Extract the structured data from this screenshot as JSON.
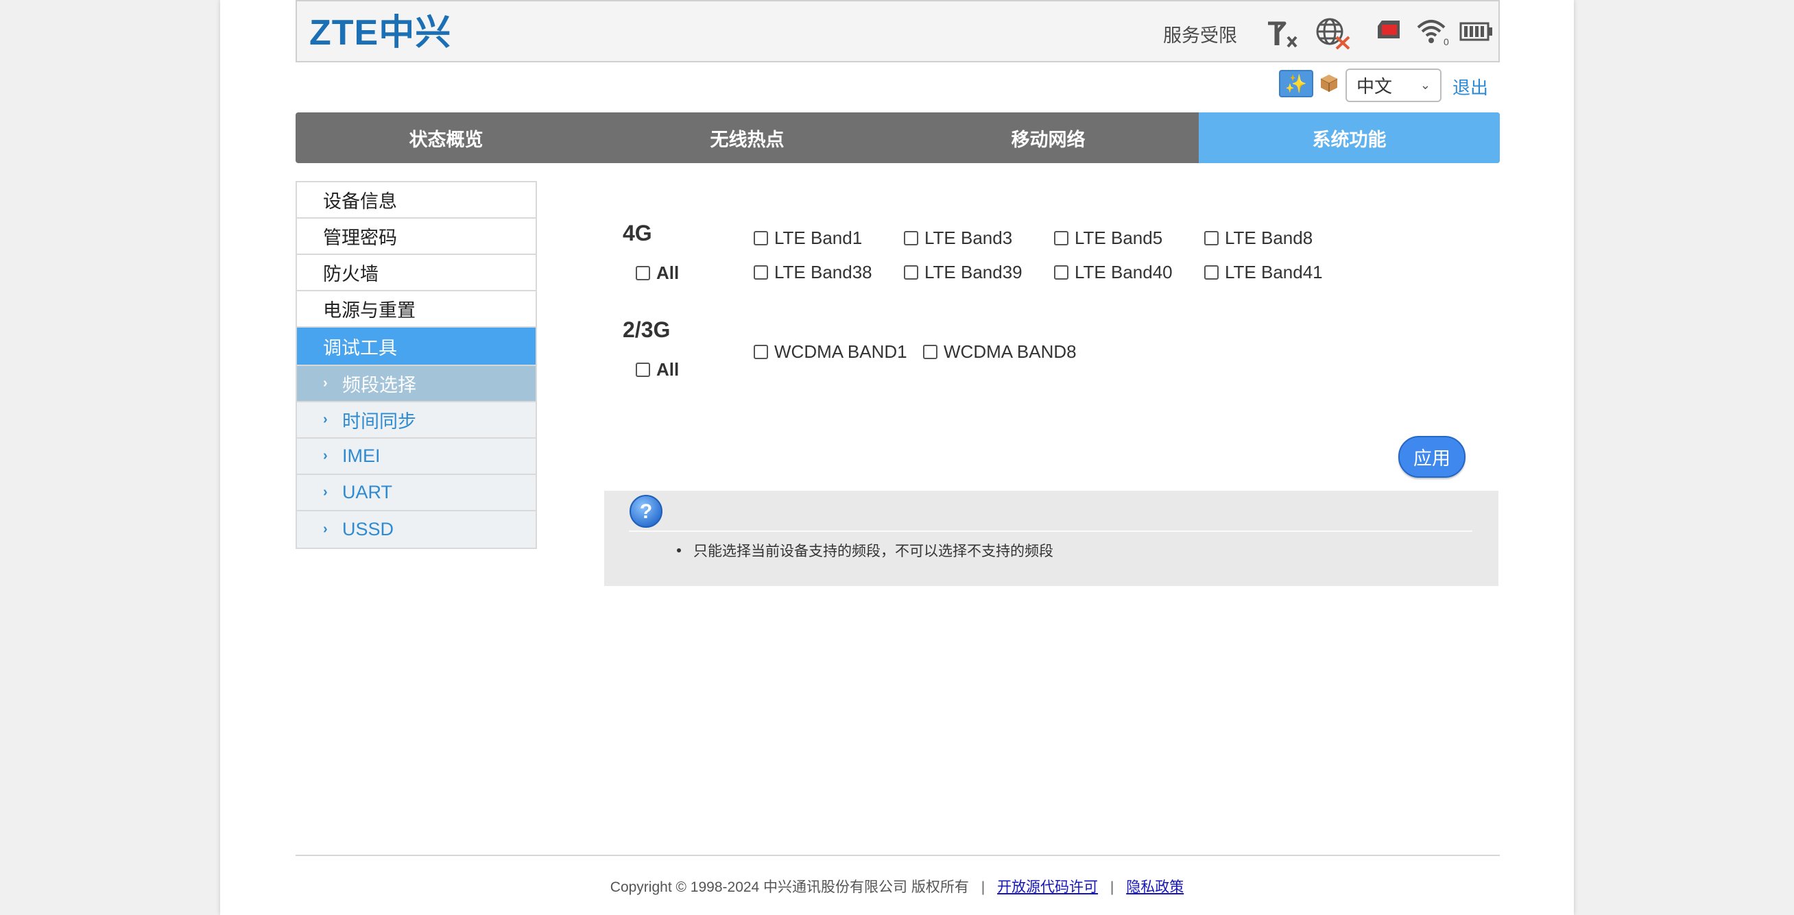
{
  "header": {
    "logo": "ZTE中兴",
    "status_text": "服务受限",
    "icons": [
      "signal-none-icon",
      "no-internet-globe-icon",
      "sim-card-icon",
      "wifi-icon",
      "battery-icon"
    ],
    "wifi_clients": "0"
  },
  "toolbar": {
    "language": "中文",
    "logout": "退出"
  },
  "nav": {
    "tabs": [
      {
        "label": "状态概览",
        "active": false
      },
      {
        "label": "无线热点",
        "active": false
      },
      {
        "label": "移动网络",
        "active": false
      },
      {
        "label": "系统功能",
        "active": true
      }
    ]
  },
  "sidebar": {
    "items": [
      {
        "label": "设备信息"
      },
      {
        "label": "管理密码"
      },
      {
        "label": "防火墙"
      },
      {
        "label": "电源与重置"
      },
      {
        "label": "调试工具",
        "active": true
      }
    ],
    "sub_items": [
      {
        "label": "频段选择",
        "active": true
      },
      {
        "label": "时间同步"
      },
      {
        "label": "IMEI"
      },
      {
        "label": "UART"
      },
      {
        "label": "USSD"
      }
    ]
  },
  "bands": {
    "group_4g": {
      "label": "4G",
      "all_label": "All",
      "bands": [
        "LTE Band1",
        "LTE Band3",
        "LTE Band5",
        "LTE Band8",
        "LTE Band38",
        "LTE Band39",
        "LTE Band40",
        "LTE Band41"
      ]
    },
    "group_23g": {
      "label": "2/3G",
      "all_label": "All",
      "bands": [
        "WCDMA BAND1",
        "WCDMA BAND8"
      ]
    }
  },
  "apply_label": "应用",
  "help": {
    "note": "只能选择当前设备支持的频段，不可以选择不支持的频段"
  },
  "footer": {
    "copyright": "Copyright © 1998-2024 中兴通讯股份有限公司 版权所有",
    "link_opensource": "开放源代码许可",
    "link_privacy": "隐私政策"
  },
  "colors": {
    "accent": "#5fb2f0",
    "nav_bg": "#707070",
    "sidebar_active": "#48a4ee",
    "apply_button": "#3f89ee",
    "link": "#2a8ad6"
  }
}
